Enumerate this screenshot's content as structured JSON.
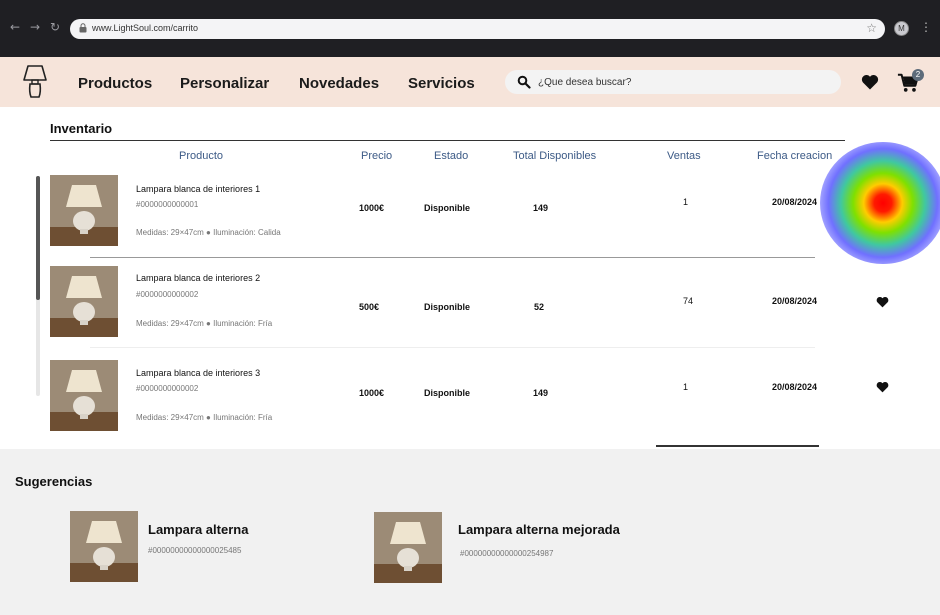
{
  "browser": {
    "url": "www.LightSoul.com/carrito",
    "profile_initial": "M"
  },
  "header": {
    "menu": [
      "Productos",
      "Personalizar",
      "Novedades",
      "Servicios"
    ],
    "search_placeholder": "¿Que desea buscar?",
    "cart_count": "2",
    "background": "#f6e4da"
  },
  "inventory": {
    "title": "Inventario",
    "columns": [
      "Producto",
      "Precio",
      "Estado",
      "Total Disponibles",
      "Ventas",
      "Fecha creacion"
    ],
    "rows": [
      {
        "name": "Lampara blanca de interiores 1",
        "code": "#0000000000001",
        "meta": "Medidas: 29×47cm  ●  Iluminación: Calida",
        "price": "1000€",
        "status": "Disponible",
        "available": "149",
        "sales": "1",
        "date": "20/08/2024",
        "favorite": false
      },
      {
        "name": "Lampara blanca de interiores 2",
        "code": "#0000000000002",
        "meta": "Medidas: 29×47cm  ●  Iluminación: Fría",
        "price": "500€",
        "status": "Disponible",
        "available": "52",
        "sales": "74",
        "date": "20/08/2024",
        "favorite": true
      },
      {
        "name": "Lampara blanca de interiores 3",
        "code": "#0000000000002",
        "meta": "Medidas: 29×47cm  ●  Iluminación: Fría",
        "price": "1000€",
        "status": "Disponible",
        "available": "149",
        "sales": "1",
        "date": "20/08/2024",
        "favorite": true
      }
    ]
  },
  "suggestions": {
    "title": "Sugerencias",
    "items": [
      {
        "name": "Lampara alterna",
        "code": "#00000000000000025485"
      },
      {
        "name": "Lampara alterna mejorada",
        "code": "#00000000000000254987"
      }
    ]
  },
  "colors": {
    "column_header": "#3c5a86",
    "suggestions_bg": "#f1f1f1"
  }
}
